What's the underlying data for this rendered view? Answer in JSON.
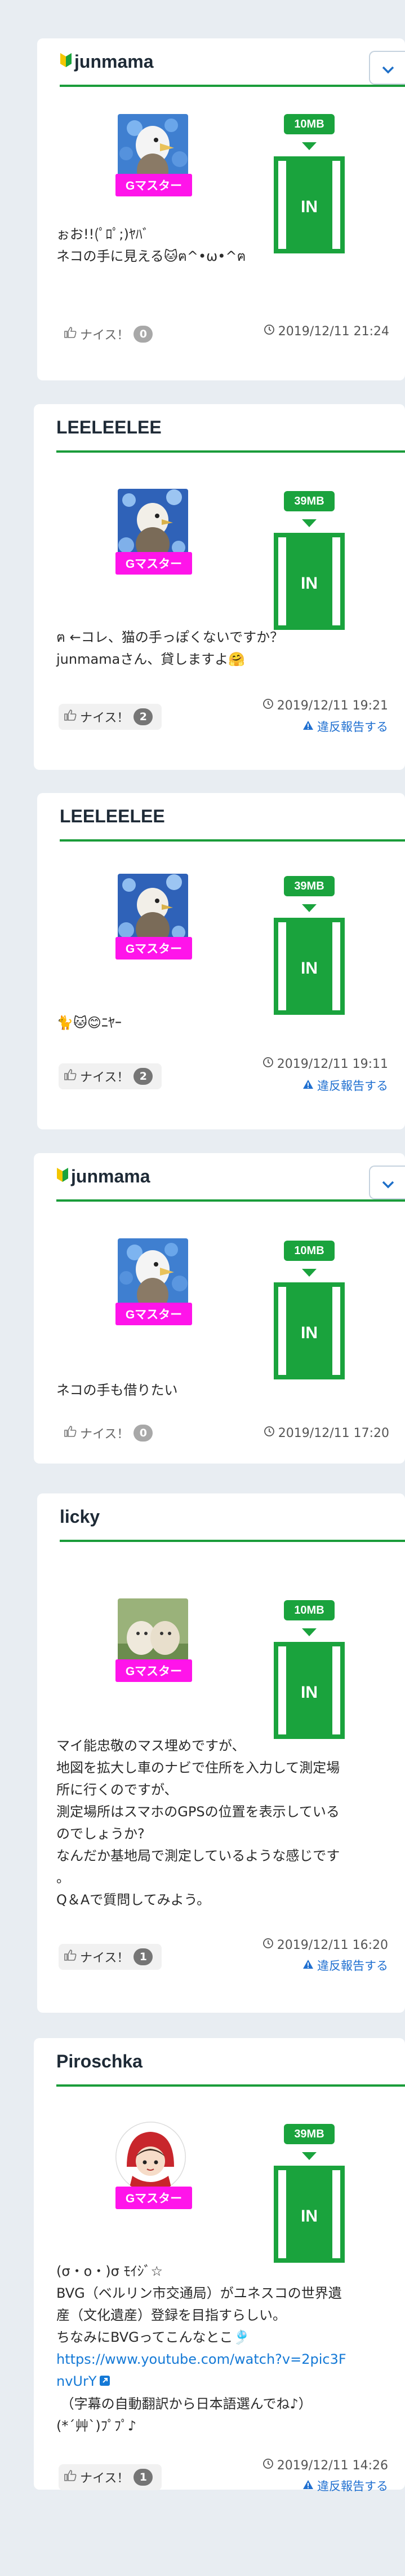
{
  "posts": [
    {
      "username": "junmama",
      "beginner": true,
      "has_menu": true,
      "avatar": "bird",
      "badge": "Gマスター",
      "size": "10MB",
      "in_label": "IN",
      "text_lines": [
        "ぉお!!(ﾟﾛﾟ;)ﾔﾊﾞ",
        "ネコの手に見える🐱ฅ^•ω•^ฅ"
      ],
      "nice_label": "ナイス！",
      "nice_count": "0",
      "timestamp": "2019/12/11 21:24",
      "report": ""
    },
    {
      "username": "LEELEELEE",
      "beginner": false,
      "has_menu": false,
      "avatar": "flower",
      "badge": "Gマスター",
      "size": "39MB",
      "in_label": "IN",
      "text_lines": [
        "ฅ ←コレ、猫の手っぽくないですか？",
        "junmamaさん、貸しますよ🤗"
      ],
      "nice_label": "ナイス！",
      "nice_count": "2",
      "timestamp": "2019/12/11 19:21",
      "report": "違反報告する"
    },
    {
      "username": "LEELEELEE",
      "beginner": false,
      "has_menu": false,
      "avatar": "flower",
      "badge": "Gマスター",
      "size": "39MB",
      "in_label": "IN",
      "text_lines": [
        "🐈🐱😊ﾆﾔｰ"
      ],
      "nice_label": "ナイス！",
      "nice_count": "2",
      "timestamp": "2019/12/11 19:11",
      "report": "違反報告する"
    },
    {
      "username": "junmama",
      "beginner": true,
      "has_menu": true,
      "avatar": "bird",
      "badge": "Gマスター",
      "size": "10MB",
      "in_label": "IN",
      "text_lines": [
        "ネコの手も借りたい"
      ],
      "nice_label": "ナイス！",
      "nice_count": "0",
      "timestamp": "2019/12/11 17:20",
      "report": ""
    },
    {
      "username": "licky",
      "beginner": false,
      "has_menu": false,
      "avatar": "dogs",
      "badge": "Gマスター",
      "size": "10MB",
      "in_label": "IN",
      "text_lines": [
        "マイ能忠敬のマス埋めですが、",
        "地図を拡大し車のナビで住所を入力して測定場",
        "所に行くのですが、",
        "測定場所はスマホのGPSの位置を表示している",
        "のでしょうか?",
        "なんだか基地局で測定しているような感じです",
        "。",
        "Q＆Aで質問してみよう。"
      ],
      "nice_label": "ナイス！",
      "nice_count": "1",
      "timestamp": "2019/12/11 16:20",
      "report": "違反報告する"
    },
    {
      "username": "Piroschka",
      "beginner": false,
      "has_menu": false,
      "avatar": "redhood",
      "badge": "Gマスター",
      "size": "39MB",
      "in_label": "IN",
      "text_lines": [
        "(σ・ο・)σ ﾓｲｼﾞ☆",
        "BVG（ベルリン市交通局）がユネスコの世界遺",
        "産（文化遺産）登録を目指すらしい。",
        "ちなみにBVGってこんなとこ🎐"
      ],
      "link_lines": [
        "https://www.youtube.com/watch?v=2pic3F",
        "nvUrY"
      ],
      "text_lines_after": [
        " （字幕の自動翻訳から日本語選んでね♪）",
        "(*´艸`)ﾌﾟﾌﾟ♪"
      ],
      "nice_label": "ナイス！",
      "nice_count": "1",
      "timestamp": "2019/12/11 14:26",
      "report": "違反報告する"
    }
  ],
  "colors": {
    "accent_green": "#1aa33d",
    "badge_pink": "#ff14ea",
    "link_blue": "#1479d6",
    "page_bg": "#e8edf2"
  }
}
